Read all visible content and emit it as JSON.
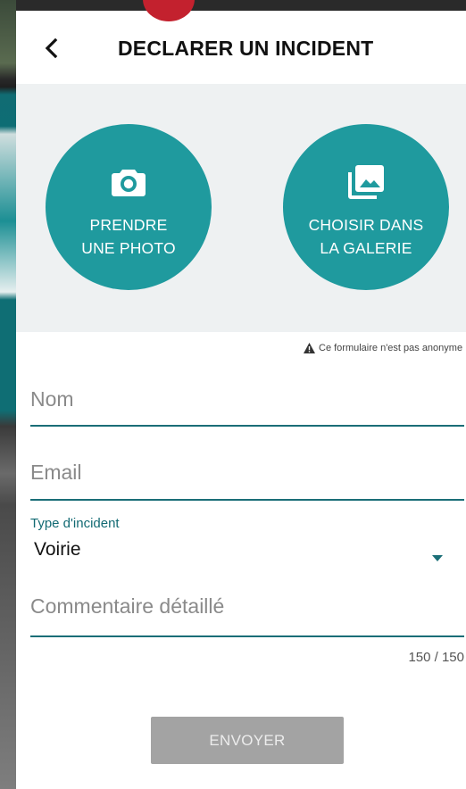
{
  "colors": {
    "accent": "#1f9a9e",
    "underline": "#1a6e77",
    "panel_background": "#eef1f2",
    "disabled_button": "#a3a3a3"
  },
  "header": {
    "back_icon": "chevron-left-icon",
    "title": "DECLARER UN INCIDENT"
  },
  "photo_panel": {
    "take_photo": {
      "icon": "camera-icon",
      "line1": "PRENDRE",
      "line2": "UNE PHOTO"
    },
    "gallery": {
      "icon": "gallery-icon",
      "line1": "CHOISIR DANS",
      "line2": "LA GALERIE"
    }
  },
  "notice": {
    "icon": "warning-icon",
    "text": "Ce formulaire n'est pas anonyme"
  },
  "form": {
    "name_placeholder": "Nom",
    "email_placeholder": "Email",
    "type_label": "Type d'incident",
    "type_value": "Voirie",
    "comment_placeholder": "Commentaire détaillé",
    "char_counter": "150 / 150"
  },
  "submit_label": "ENVOYER"
}
